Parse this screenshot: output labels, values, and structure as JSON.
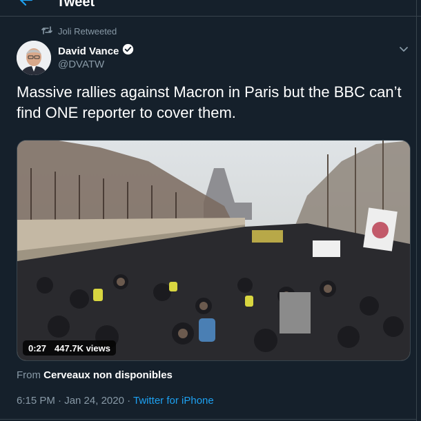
{
  "header": {
    "title": "Tweet",
    "back_icon": "arrow-left-icon"
  },
  "social_context": {
    "icon": "retweet-icon",
    "text": "Joli Retweeted"
  },
  "author": {
    "name": "David Vance",
    "handle": "@DVATW",
    "verified": true,
    "verified_icon": "verified-badge-icon"
  },
  "menu_icon": "chevron-down-icon",
  "tweet": {
    "text": "Massive rallies against Macron in Paris but the BBC can’t find ONE reporter to cover them."
  },
  "video": {
    "duration": "0:27",
    "views": "447.7K views"
  },
  "source": {
    "prefix": "From",
    "name": "Cerveaux non disponibles"
  },
  "meta": {
    "time": "6:15 PM · Jan 24, 2020 · ",
    "client": "Twitter for iPhone"
  },
  "colors": {
    "background": "#15202b",
    "border": "#38444d",
    "secondary_text": "#8899a6",
    "accent": "#1da1f2"
  }
}
